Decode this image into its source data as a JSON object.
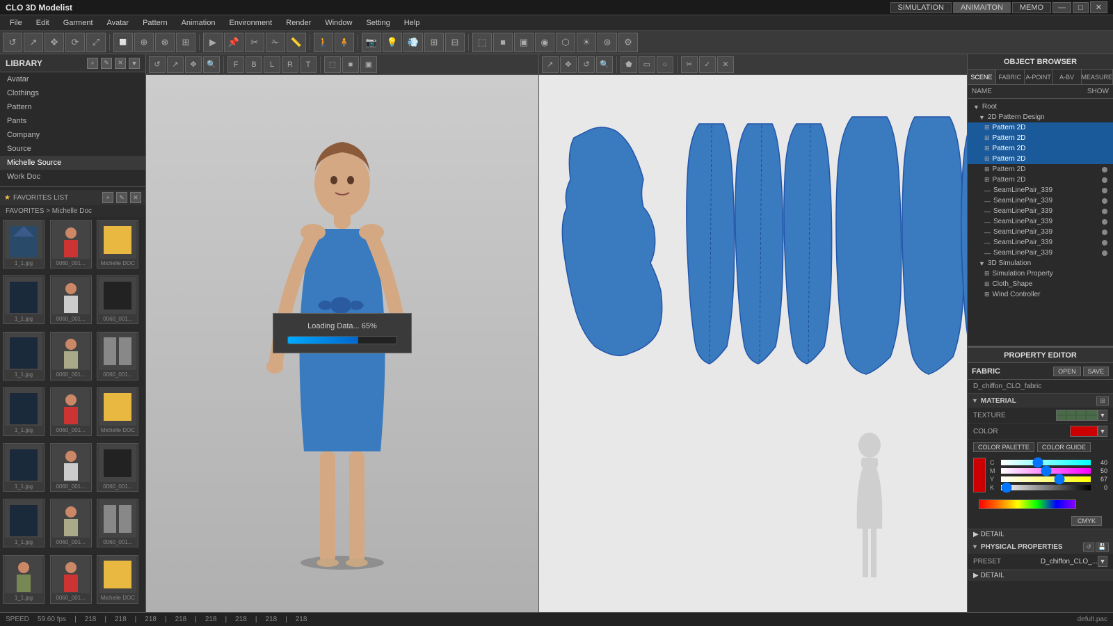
{
  "app": {
    "title": "CLO 3D Modelist",
    "logo": "CLO 3D Modelist"
  },
  "topbar": {
    "simulation_tab": "SIMULATION",
    "animation_tab": "ANIMAITON",
    "memo_tab": "MEMO",
    "win_btns": [
      "—",
      "□",
      "✕"
    ]
  },
  "menubar": {
    "items": [
      "File",
      "Edit",
      "Garment",
      "Avatar",
      "Pattern",
      "Animation",
      "Environment",
      "Render",
      "Window",
      "Setting",
      "Help"
    ]
  },
  "sidebar": {
    "title": "LIBRARY",
    "nav_items": [
      "Avatar",
      "Clothings",
      "Pattern",
      "Pants",
      "Company",
      "Source",
      "Michelle Source",
      "Work Doc"
    ],
    "active_item": "Michelle Source",
    "favorites_label": "FAVORITES LIST",
    "breadcrumb": "FAVORITES > Michelle Doc",
    "thumbnails": [
      {
        "label": "1_1.jpg"
      },
      {
        "label": "0060_001..."
      },
      {
        "label": "Michelle DOC"
      },
      {
        "label": "1_1.jpg"
      },
      {
        "label": "0060_001..."
      },
      {
        "label": "0060_001..."
      },
      {
        "label": "1_1.jpg"
      },
      {
        "label": "0060_001..."
      },
      {
        "label": "0060_001..."
      },
      {
        "label": "1_1.jpg"
      },
      {
        "label": "0060_001..."
      },
      {
        "label": "Michelle DOC"
      },
      {
        "label": "1_1.jpg"
      },
      {
        "label": "0060_001..."
      },
      {
        "label": "0060_001..."
      },
      {
        "label": "1_1.jpg"
      },
      {
        "label": "0060_001..."
      },
      {
        "label": "0060_001..."
      },
      {
        "label": "1_1.jpg"
      },
      {
        "label": "0060_001..."
      },
      {
        "label": "Michelle DOC"
      }
    ]
  },
  "object_browser": {
    "title": "OBJECT BROWSER",
    "tabs": [
      "SCENE",
      "FABRIC",
      "A-POINT",
      "A-BV",
      "MEASURE"
    ],
    "name_label": "NAME",
    "show_label": "SHOW",
    "tree": [
      {
        "label": "Root",
        "indent": 0,
        "type": "root"
      },
      {
        "label": "2D Pattern Design",
        "indent": 1,
        "type": "group"
      },
      {
        "label": "Pattern 2D",
        "indent": 2,
        "type": "item",
        "selected": true
      },
      {
        "label": "Pattern 2D",
        "indent": 2,
        "type": "item",
        "selected": true
      },
      {
        "label": "Pattern 2D",
        "indent": 2,
        "type": "item",
        "selected": true
      },
      {
        "label": "Pattern 2D",
        "indent": 2,
        "type": "item",
        "selected": true
      },
      {
        "label": "Pattern 2D",
        "indent": 2,
        "type": "item",
        "dot": true
      },
      {
        "label": "Pattern 2D",
        "indent": 2,
        "type": "item",
        "dot": true
      },
      {
        "label": "SeamLinePair_339",
        "indent": 2,
        "type": "item",
        "dot": true
      },
      {
        "label": "SeamLinePair_339",
        "indent": 2,
        "type": "item",
        "dot": true
      },
      {
        "label": "SeamLinePair_339",
        "indent": 2,
        "type": "item",
        "dot": true
      },
      {
        "label": "SeamLinePair_339",
        "indent": 2,
        "type": "item",
        "dot": true
      },
      {
        "label": "SeamLinePair_339",
        "indent": 2,
        "type": "item",
        "dot": true
      },
      {
        "label": "SeamLinePair_339",
        "indent": 2,
        "type": "item",
        "dot": true
      },
      {
        "label": "SeamLinePair_339",
        "indent": 2,
        "type": "item",
        "dot": true
      },
      {
        "label": "3D Simulation",
        "indent": 1,
        "type": "group"
      },
      {
        "label": "Simulation Property",
        "indent": 2,
        "type": "item"
      },
      {
        "label": "Cloth_Shape",
        "indent": 2,
        "type": "item"
      },
      {
        "label": "Wind Controller",
        "indent": 2,
        "type": "item"
      }
    ]
  },
  "property_editor": {
    "title": "PROPERTY EDITOR",
    "fabric_label": "FABRIC",
    "open_btn": "OPEN",
    "save_btn": "SAVE",
    "fabric_name": "D_chiffon_CLO_fabric",
    "material_label": "MATERIAL",
    "texture_label": "TEXTURE",
    "texture_value": "",
    "color_label": "COLOR",
    "color_palette_btn": "COLOR PALETTE",
    "color_guide_btn": "COLOR GUIDE",
    "color_hex": "#cc0000",
    "cmyk": {
      "c_label": "C",
      "c_val": "40",
      "m_label": "M",
      "m_val": "50",
      "y_label": "Y",
      "y_val": "67",
      "k_label": "K",
      "k_val": "0"
    },
    "cmyk_btn": "CMYK",
    "detail_label": "DETAIL",
    "physical_properties_label": "PHYSICAL PROPERTIES",
    "preset_label": "PRESET",
    "preset_value": "D_chiffon_CLO_...",
    "detail2_label": "DETAIL"
  },
  "loading": {
    "text": "Loading Data... 65%",
    "progress": 65
  },
  "statusbar": {
    "speed_label": "SPEED",
    "fps": "59.60 fps",
    "values": [
      "218",
      "218",
      "218",
      "218",
      "218",
      "218",
      "218",
      "218"
    ],
    "filename": "defult.pac"
  },
  "colors": {
    "selected_blue": "#1a5a9a",
    "highlight_blue": "#3a6a9a",
    "pattern_fill": "#3a7abf",
    "progress_bar": "#00aaff",
    "color_red": "#cc0000",
    "texture_green": "#5a8a5a"
  }
}
